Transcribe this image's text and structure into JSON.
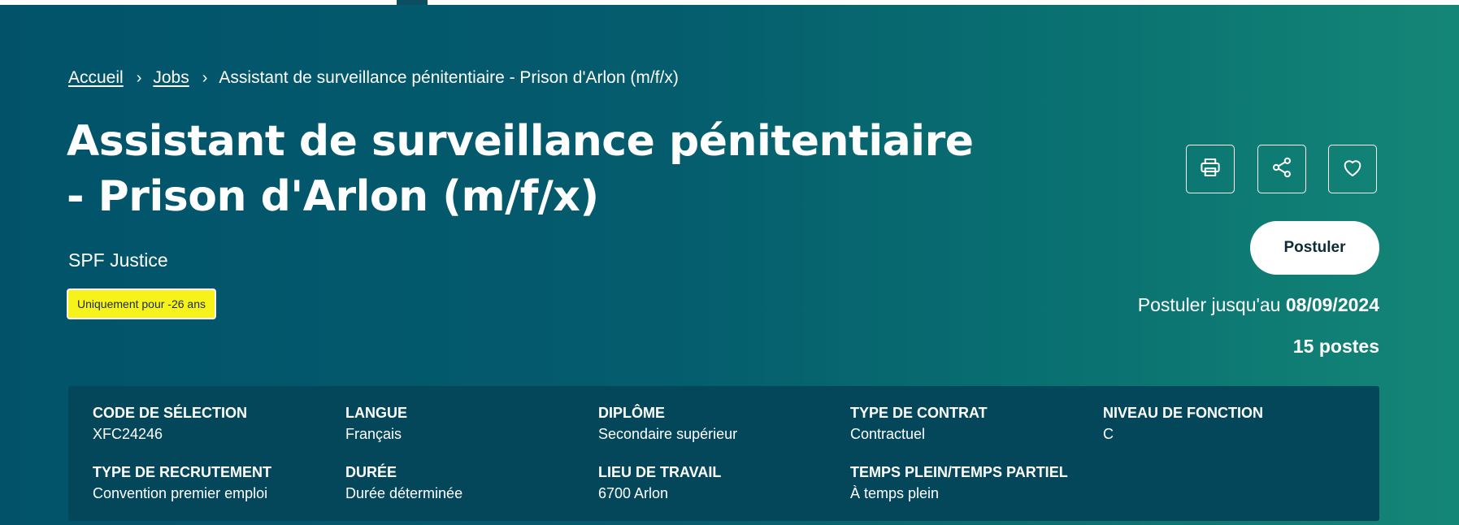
{
  "breadcrumb": {
    "home": "Accueil",
    "jobs": "Jobs",
    "current": "Assistant de surveillance pénitentiaire - Prison d'Arlon (m/f/x)",
    "separator": "›"
  },
  "job": {
    "title": "Assistant de surveillance pénitentiaire - Prison d'Arlon (m/f/x)",
    "organization": "SPF Justice",
    "badge": "Uniquement pour -26 ans"
  },
  "actions": {
    "print_icon": "printer-icon",
    "share_icon": "share-icon",
    "favorite_icon": "heart-icon",
    "apply_label": "Postuler"
  },
  "deadline": {
    "prefix": "Postuler jusqu'au",
    "date": "08/09/2024"
  },
  "positions": "15 postes",
  "details": [
    {
      "label": "CODE DE SÉLECTION",
      "value": "XFC24246"
    },
    {
      "label": "LANGUE",
      "value": "Français"
    },
    {
      "label": "DIPLÔME",
      "value": "Secondaire supérieur"
    },
    {
      "label": "TYPE DE CONTRAT",
      "value": "Contractuel"
    },
    {
      "label": "NIVEAU DE FONCTION",
      "value": "C"
    },
    {
      "label": "TYPE DE RECRUTEMENT",
      "value": "Convention premier emploi"
    },
    {
      "label": "DURÉE",
      "value": "Durée déterminée"
    },
    {
      "label": "LIEU DE TRAVAIL",
      "value": "6700 Arlon"
    },
    {
      "label": "TEMPS PLEIN/TEMPS PARTIEL",
      "value": "À temps plein"
    }
  ],
  "colors": {
    "background_start": "#02536a",
    "background_end": "#148677",
    "panel": "#05475a",
    "badge": "#f6f31a"
  }
}
